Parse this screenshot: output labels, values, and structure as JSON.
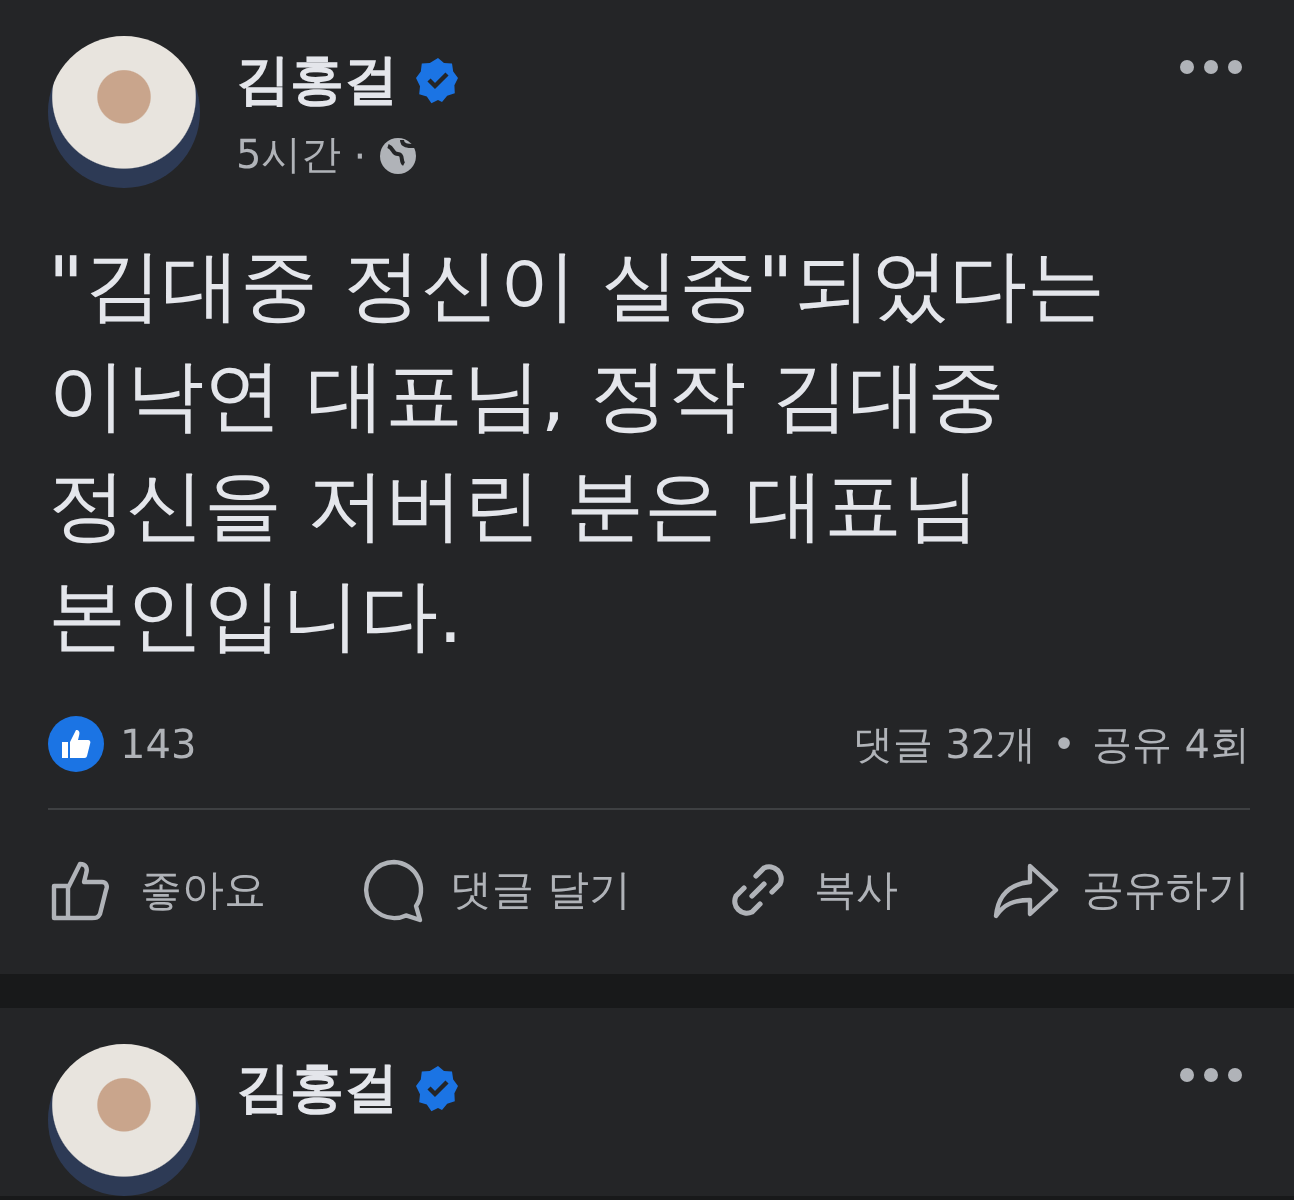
{
  "posts": [
    {
      "author": "김홍걸",
      "verified": true,
      "time": "5시간",
      "separator": "·",
      "body": "\"김대중 정신이 실종\"되었다는\n이낙연 대표님, 정작 김대중\n정신을 저버린 분은 대표님\n본인입니다.",
      "reactions": "143",
      "comments": "댓글 32개",
      "dot": "•",
      "shares": "공유 4회",
      "actions": [
        {
          "kind": "like",
          "label": "좋아요"
        },
        {
          "kind": "comment",
          "label": "댓글 달기"
        },
        {
          "kind": "copy",
          "label": "복사"
        },
        {
          "kind": "share",
          "label": "공유하기"
        }
      ]
    },
    {
      "author": "김홍걸",
      "verified": true
    }
  ]
}
